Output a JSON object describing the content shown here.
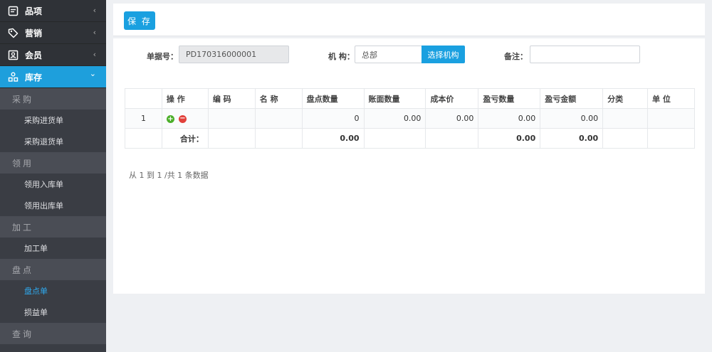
{
  "sidebar": {
    "top_items": [
      {
        "label": "品项",
        "icon": "doc-icon"
      },
      {
        "label": "营销",
        "icon": "tag-icon"
      },
      {
        "label": "会员",
        "icon": "member-card-icon"
      },
      {
        "label": "库存",
        "icon": "inventory-icon",
        "active": true
      }
    ],
    "groups": [
      {
        "label": "采购",
        "items": [
          "采购进货单",
          "采购退货单"
        ]
      },
      {
        "label": "领用",
        "items": [
          "领用入库单",
          "领用出库单"
        ]
      },
      {
        "label": "加工",
        "items": [
          "加工单"
        ]
      },
      {
        "label": "盘点",
        "items": [
          "盘点单",
          "损益单"
        ],
        "active_item": "盘点单"
      },
      {
        "label": "查询",
        "items": []
      }
    ],
    "collapsed_chevron": "‹",
    "expanded_chevron": "⌄",
    "accent_color": "#1e9fdc"
  },
  "toolbar": {
    "save_label": "保 存"
  },
  "form": {
    "doc_no_label": "单据号：",
    "doc_no_value": "PD170316000001",
    "org_label": "机 构：",
    "org_value": "总部",
    "org_button": "选择机构",
    "remark_label": "备注：",
    "remark_value": ""
  },
  "table": {
    "headers": [
      "",
      "操 作",
      "编 码",
      "名 称",
      "盘点数量",
      "账面数量",
      "成本价",
      "盈亏数量",
      "盈亏金额",
      "分类",
      "单 位"
    ],
    "rows": [
      {
        "index": "1",
        "code": "",
        "name": "",
        "count_qty": "0",
        "book_qty": "0.00",
        "cost": "0.00",
        "pl_qty": "0.00",
        "pl_amount": "0.00",
        "category": "",
        "unit": ""
      }
    ],
    "total_label": "合计：",
    "totals": {
      "count_qty": "0.00",
      "pl_qty": "0.00",
      "pl_amount": "0.00"
    }
  },
  "pager": {
    "summary": "从 1 到 1 /共 1 条数据"
  }
}
